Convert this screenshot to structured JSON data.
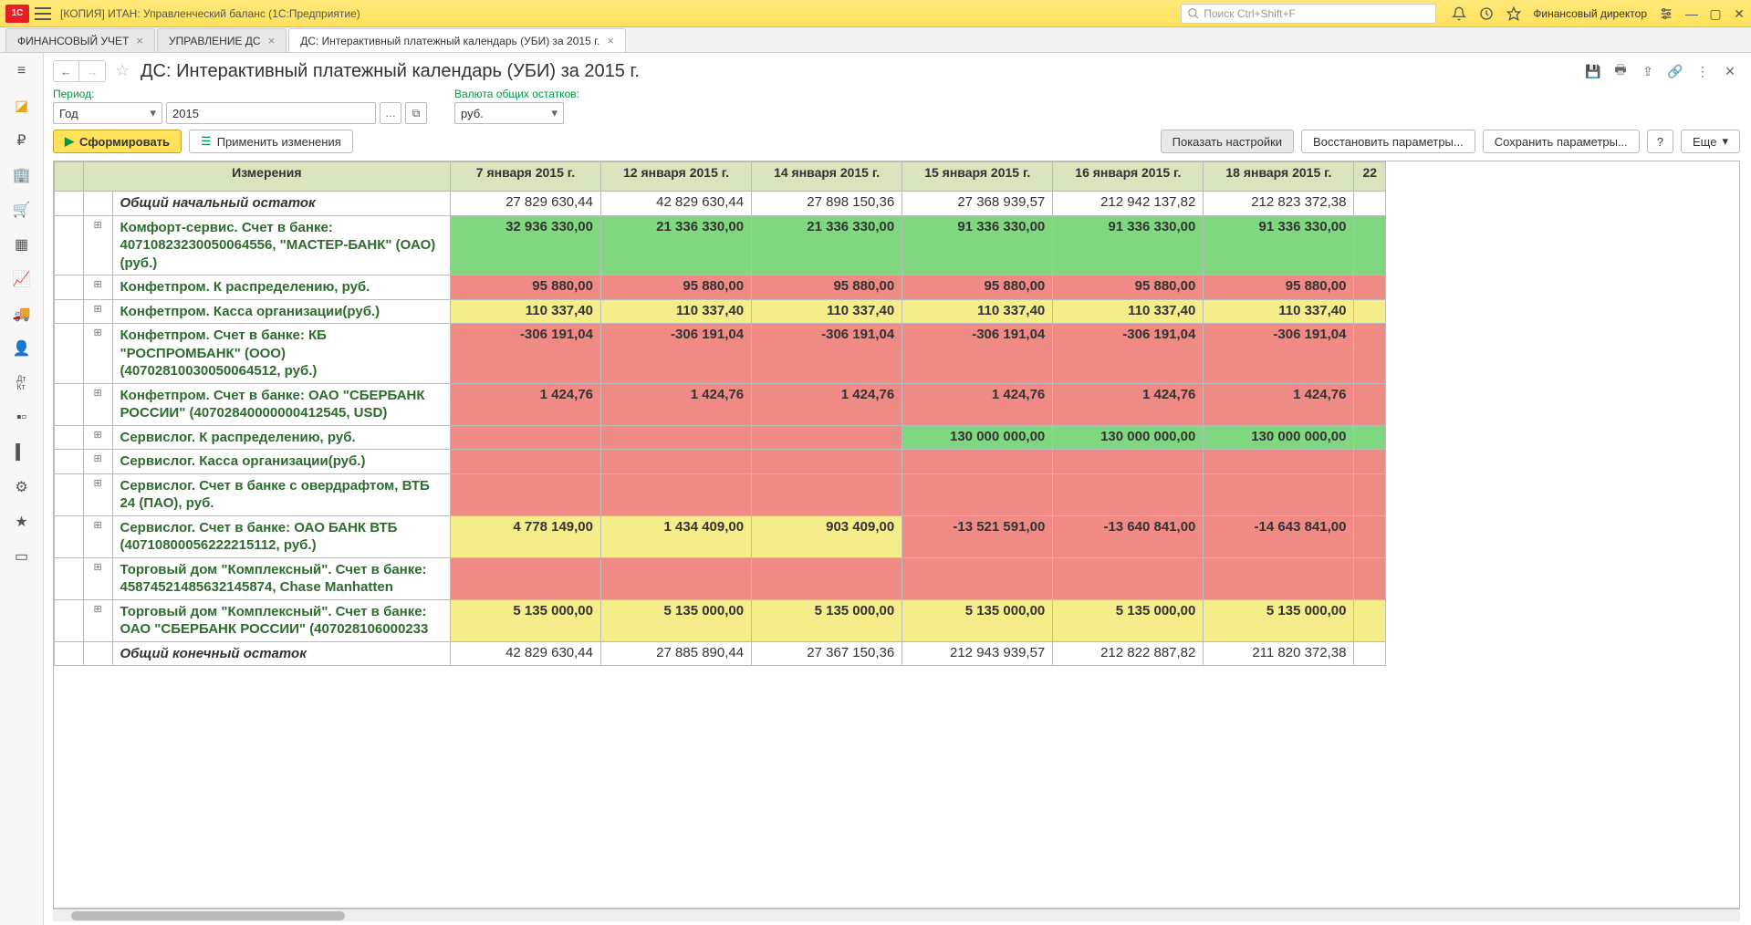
{
  "titlebar": {
    "app_title": "[КОПИЯ] ИТАН: Управленческий баланс  (1С:Предприятие)",
    "search_placeholder": "Поиск Ctrl+Shift+F",
    "user": "Финансовый директор"
  },
  "tabs": [
    {
      "label": "ФИНАНСОВЫЙ УЧЕТ"
    },
    {
      "label": "УПРАВЛЕНИЕ ДС"
    },
    {
      "label": "ДС: Интерактивный платежный календарь (УБИ)  за 2015 г."
    }
  ],
  "page": {
    "title": "ДС: Интерактивный платежный календарь (УБИ)  за 2015 г."
  },
  "params": {
    "period_label": "Период:",
    "period_type": "Год",
    "period_value": "2015",
    "currency_label": "Валюта общих остатков:",
    "currency_value": "руб."
  },
  "buttons": {
    "generate": "Сформировать",
    "apply": "Применить изменения",
    "show_settings": "Показать настройки",
    "restore": "Восстановить параметры...",
    "save": "Сохранить параметры...",
    "help": "?",
    "more": "Еще"
  },
  "grid": {
    "header_dim": "Измерения",
    "header_last": "22",
    "dates": [
      "7 января 2015 г.",
      "12 января 2015 г.",
      "14 января 2015 г.",
      "15 января 2015 г.",
      "16 января 2015 г.",
      "18 января 2015 г."
    ],
    "rows": [
      {
        "expand": "",
        "dim": "Общий начальный остаток",
        "ital": true,
        "bg": "white",
        "total": true,
        "vals": [
          "27 829 630,44",
          "42 829 630,44",
          "27 898 150,36",
          "27 368 939,57",
          "212 942 137,82",
          "212 823 372,38"
        ]
      },
      {
        "expand": "+",
        "dim": "Комфорт-сервис. Счет в банке: 40710823230050064556, \"МАСТЕР-БАНК\" (ОАО)(руб.)",
        "bg": "green",
        "vals": [
          "32 936 330,00",
          "21 336 330,00",
          "21 336 330,00",
          "91 336 330,00",
          "91 336 330,00",
          "91 336 330,00"
        ]
      },
      {
        "expand": "+",
        "dim": "Конфетпром. К распределению, руб.",
        "bg": "red",
        "vals": [
          "95 880,00",
          "95 880,00",
          "95 880,00",
          "95 880,00",
          "95 880,00",
          "95 880,00"
        ]
      },
      {
        "expand": "+",
        "dim": "Конфетпром. Касса организации(руб.)",
        "bg": "yellow",
        "vals": [
          "110 337,40",
          "110 337,40",
          "110 337,40",
          "110 337,40",
          "110 337,40",
          "110 337,40"
        ]
      },
      {
        "expand": "+",
        "dim": "Конфетпром. Счет в банке: КБ \"РОСПРОМБАНК\" (ООО) (40702810030050064512, руб.)",
        "bg": "red",
        "vals": [
          "-306 191,04",
          "-306 191,04",
          "-306 191,04",
          "-306 191,04",
          "-306 191,04",
          "-306 191,04"
        ]
      },
      {
        "expand": "+",
        "dim": "Конфетпром. Счет в банке: ОАО \"СБЕРБАНК РОССИИ\" (40702840000000412545, USD)",
        "bg": "red",
        "vals": [
          "1 424,76",
          "1 424,76",
          "1 424,76",
          "1 424,76",
          "1 424,76",
          "1 424,76"
        ]
      },
      {
        "expand": "+",
        "dim": "Сервислог. К распределению, руб.",
        "bg": "mixed",
        "bgvals": [
          "red",
          "red",
          "red",
          "green",
          "green",
          "green"
        ],
        "vals": [
          "",
          "",
          "",
          "130 000 000,00",
          "130 000 000,00",
          "130 000 000,00"
        ]
      },
      {
        "expand": "+",
        "dim": "Сервислог. Касса организации(руб.)",
        "bg": "red",
        "vals": [
          "",
          "",
          "",
          "",
          "",
          ""
        ]
      },
      {
        "expand": "+",
        "dim": "Сервислог. Счет в банке с овердрафтом, ВТБ 24 (ПАО), руб.",
        "bg": "red",
        "vals": [
          "",
          "",
          "",
          "",
          "",
          ""
        ]
      },
      {
        "expand": "+",
        "dim": "Сервислог. Счет в банке: ОАО БАНК ВТБ (40710800056222215112, руб.)",
        "bg": "mixed",
        "bgvals": [
          "yellow",
          "yellow",
          "yellow",
          "red",
          "red",
          "red"
        ],
        "vals": [
          "4 778 149,00",
          "1 434 409,00",
          "903 409,00",
          "-13 521 591,00",
          "-13 640 841,00",
          "-14 643 841,00"
        ]
      },
      {
        "expand": "+",
        "dim": "Торговый дом \"Комплексный\". Счет в банке: 45874521485632145874, Chase Manhatten",
        "bg": "red",
        "vals": [
          "",
          "",
          "",
          "",
          "",
          ""
        ]
      },
      {
        "expand": "+",
        "dim": "Торговый дом \"Комплексный\". Счет в банке: ОАО \"СБЕРБАНК РОССИИ\" (407028106000233",
        "bg": "yellow",
        "vals": [
          "5 135 000,00",
          "5 135 000,00",
          "5 135 000,00",
          "5 135 000,00",
          "5 135 000,00",
          "5 135 000,00"
        ]
      },
      {
        "expand": "",
        "dim": "Общий конечный остаток",
        "ital": true,
        "bg": "white",
        "total": true,
        "vals": [
          "42 829 630,44",
          "27 885 890,44",
          "27 367 150,36",
          "212 943 939,57",
          "212 822 887,82",
          "211 820 372,38"
        ]
      }
    ]
  }
}
